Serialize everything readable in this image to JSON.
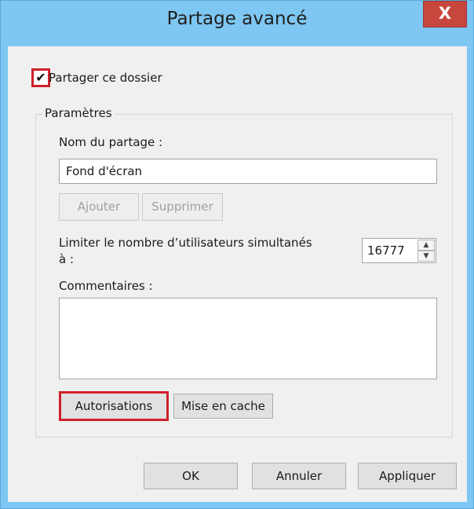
{
  "window": {
    "title": "Partage avancé",
    "close_glyph": "X"
  },
  "share_checkbox": {
    "label": "Partager ce dossier",
    "checked": true,
    "check_glyph": "✔"
  },
  "settings": {
    "group_title": "Paramètres",
    "share_name_label": "Nom du partage :",
    "share_name_value": "Fond d'écran",
    "add_button": "Ajouter",
    "remove_button": "Supprimer",
    "limit_label_line1": "Limiter le nombre d’utilisateurs simultanés",
    "limit_label_line2": "à :",
    "limit_value": "16777",
    "comments_label": "Commentaires :",
    "comments_value": "",
    "permissions_button": "Autorisations",
    "caching_button": "Mise en cache"
  },
  "footer": {
    "ok": "OK",
    "cancel": "Annuler",
    "apply": "Appliquer"
  },
  "colors": {
    "frame": "#7ec7f2",
    "close": "#c7473e",
    "highlight": "#d0202c",
    "client": "#f0f0f0"
  },
  "icons": {
    "close": "close-icon",
    "check": "checkmark-icon",
    "spin_up": "chevron-up-icon",
    "spin_down": "chevron-down-icon"
  }
}
